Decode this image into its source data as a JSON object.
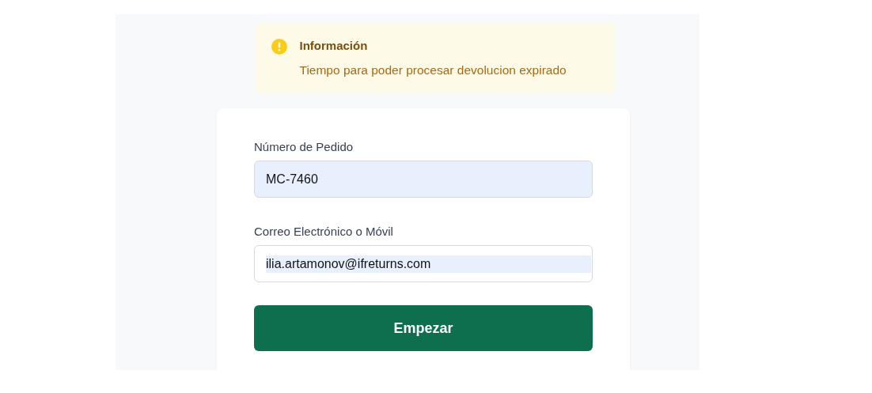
{
  "alert": {
    "title": "Información",
    "message": "Tiempo para poder procesar devolucion expirado"
  },
  "form": {
    "fields": [
      {
        "label": "Número de Pedido",
        "value": "MC-7460",
        "autofilled": true,
        "value_selected": false
      },
      {
        "label": "Correo Electrónico o Móvil",
        "value": "ilia.artamonov@ifreturns.com",
        "autofilled": false,
        "value_selected": true
      }
    ],
    "submit": "Empezar"
  }
}
